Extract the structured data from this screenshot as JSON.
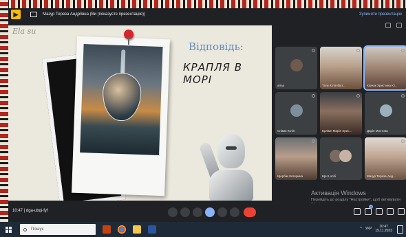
{
  "topbar": {
    "title": "Мазур Тереза Андріївна (Ви (показуєте презентацію))",
    "stop_label": "Зупинити презентацію"
  },
  "slide": {
    "scribble": "Ela su",
    "answer_label": "Відповідь:",
    "answer_text": "КРАПЛЯ В МОРІ"
  },
  "participants": [
    {
      "name": "arina"
    },
    {
      "name": "Тати Юлія Вікт..."
    },
    {
      "name": "Юрчак Христина Ю..."
    },
    {
      "name": "Співак Юлія"
    },
    {
      "name": "Ерлімп Марія Хрис..."
    },
    {
      "name": "Дарія Мостова"
    },
    {
      "name": "Щербак Катерина"
    },
    {
      "name": "Ще 5 осіб"
    },
    {
      "name": "Мазур Тереза Анд..."
    }
  ],
  "watermark": {
    "title": "Активація Windows",
    "subtitle": "Перейдіть до розділу \"Настройки\", щоб активувати Windows."
  },
  "controlbar": {
    "meeting_info": "10:47 | dga-ubqi-fyf",
    "participants_badge": "14"
  },
  "taskbar": {
    "search_placeholder": "Пошук",
    "language": "УКР",
    "time": "10:47",
    "date": "15.11.2023"
  },
  "colors": {
    "accent": "#8ab4f8",
    "end_call": "#ea4335",
    "slide_bg": "#ebe8dd"
  }
}
